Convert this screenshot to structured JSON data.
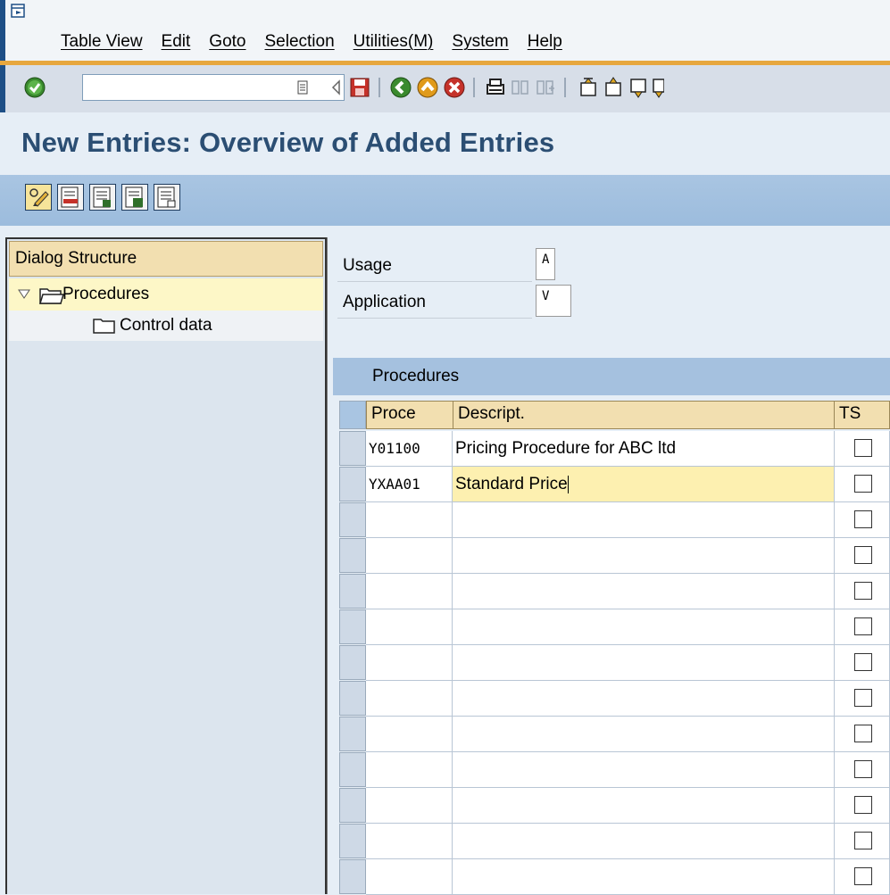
{
  "menu": {
    "items": [
      "Table View",
      "Edit",
      "Goto",
      "Selection",
      "Utilities(M)",
      "System",
      "Help"
    ]
  },
  "toolbar": {
    "command_value": "",
    "icons": [
      "enter-icon",
      "command-field-dropdown-icon",
      "back-arrow-icon",
      "save-icon",
      "back-icon",
      "exit-icon",
      "cancel-icon",
      "print-icon",
      "find-icon",
      "find-next-icon",
      "first-page-icon",
      "previous-page-icon",
      "next-page-icon",
      "last-page-icon"
    ]
  },
  "page": {
    "title": "New Entries: Overview of Added Entries"
  },
  "app_toolbar": {
    "icons": [
      "change-display-icon",
      "delete-icon",
      "select-all-icon",
      "select-block-icon",
      "deselect-all-icon"
    ]
  },
  "dialog_structure": {
    "header": "Dialog Structure",
    "items": [
      {
        "label": "Procedures",
        "expanded": true,
        "selected": true
      },
      {
        "label": "Control data",
        "expanded": false,
        "selected": false
      }
    ]
  },
  "fields": {
    "usage_label": "Usage",
    "usage_value": "A",
    "application_label": "Application",
    "application_value": "V"
  },
  "table": {
    "title": "Procedures",
    "columns": [
      "Proce",
      "Descript.",
      "TS"
    ],
    "rows": [
      {
        "code": "Y01100",
        "description": "Pricing Procedure for ABC ltd",
        "ts": false
      },
      {
        "code": "YXAA01",
        "description": "Standard Price",
        "ts": false
      },
      {
        "code": "",
        "description": "",
        "ts": false
      },
      {
        "code": "",
        "description": "",
        "ts": false
      },
      {
        "code": "",
        "description": "",
        "ts": false
      },
      {
        "code": "",
        "description": "",
        "ts": false
      },
      {
        "code": "",
        "description": "",
        "ts": false
      },
      {
        "code": "",
        "description": "",
        "ts": false
      },
      {
        "code": "",
        "description": "",
        "ts": false
      },
      {
        "code": "",
        "description": "",
        "ts": false
      },
      {
        "code": "",
        "description": "",
        "ts": false
      },
      {
        "code": "",
        "description": "",
        "ts": false
      },
      {
        "code": "",
        "description": "",
        "ts": false
      }
    ]
  },
  "colors": {
    "title": "#2b4e73",
    "header_bg": "#f2dfb0",
    "selected_row": "#fdf7c7",
    "accent_line": "#e7a73e"
  }
}
